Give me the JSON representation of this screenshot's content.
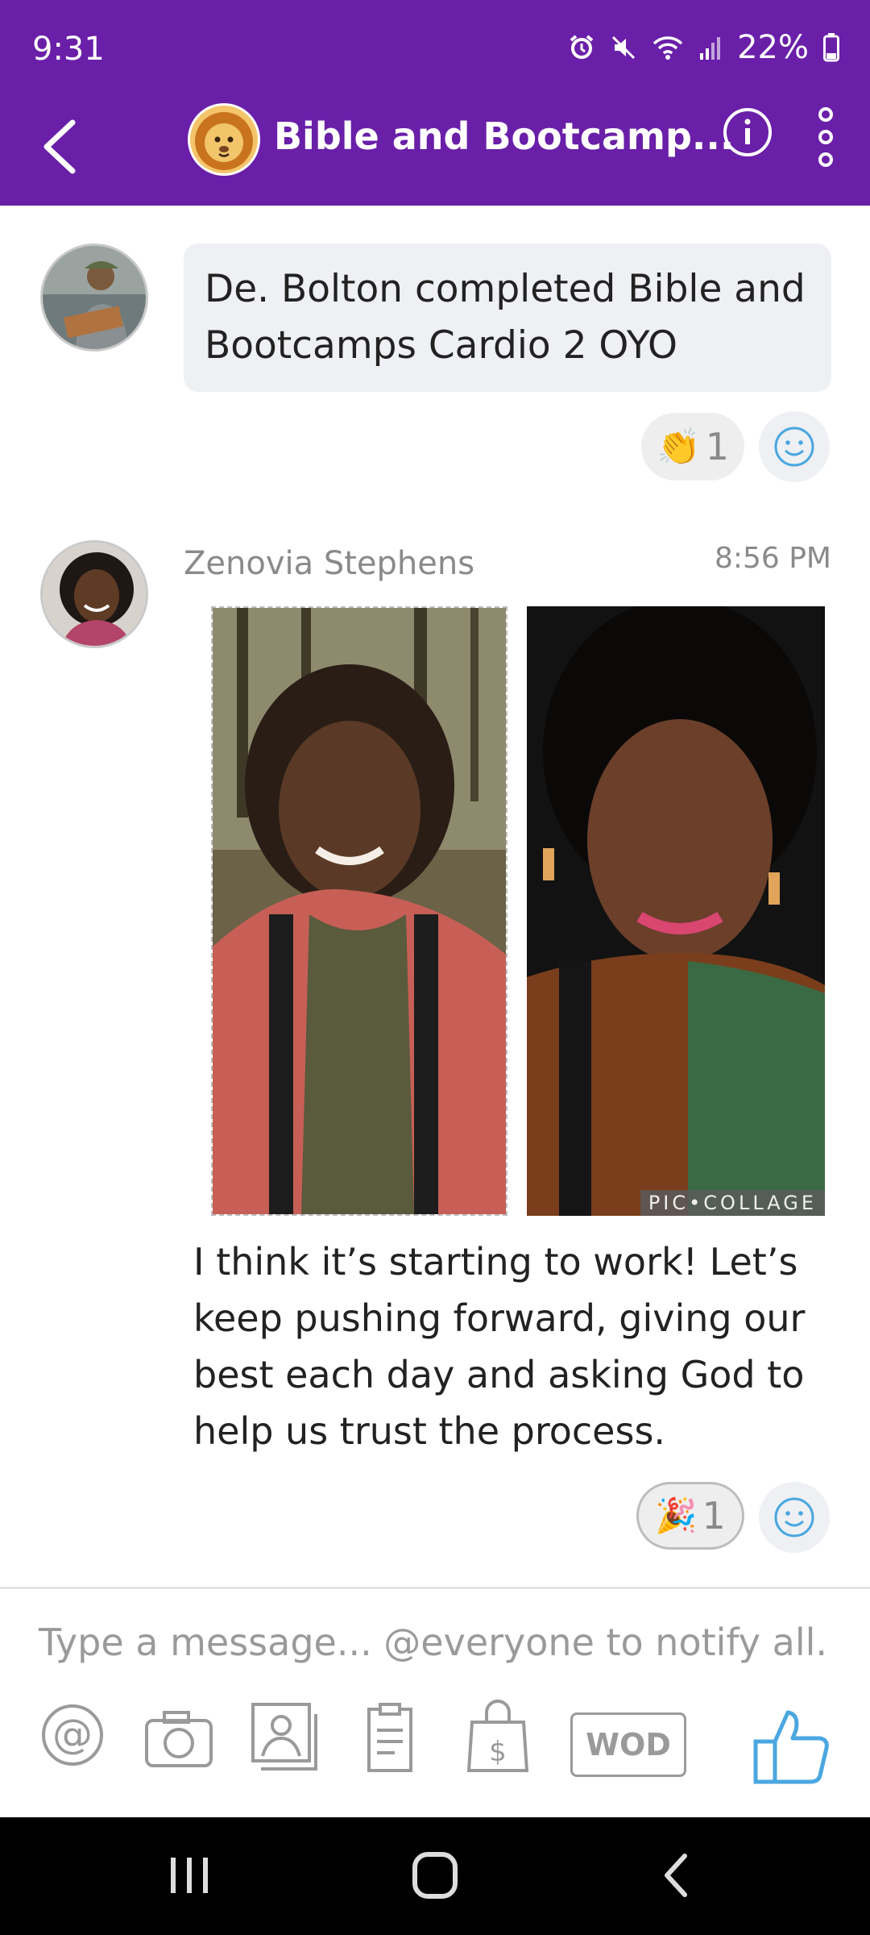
{
  "status_bar": {
    "time": "9:31",
    "battery": "22%",
    "icons": [
      "alarm-icon",
      "mute-icon",
      "wifi-icon",
      "signal-icon",
      "battery-icon"
    ]
  },
  "header": {
    "title": "Bible and Bootcamp...",
    "avatar_icon": "lion-icon"
  },
  "messages": [
    {
      "text": "De. Bolton completed Bible and Bootcamps Cardio 2 OYO",
      "reaction": {
        "emoji": "👏",
        "count": "1"
      }
    },
    {
      "author": "Zenovia Stephens",
      "time": "8:56 PM",
      "image_tag": "PIC•COLLAGE",
      "text": "I think it’s starting to work! Let’s keep pushing forward, giving our best each day and asking God to help us trust the process.",
      "reaction": {
        "emoji": "🎉",
        "count": "1"
      }
    }
  ],
  "composer": {
    "placeholder": "Type a message... @everyone to notify all.",
    "tools": [
      "mention-icon",
      "camera-icon",
      "photo-gallery-icon",
      "document-icon",
      "shop-bag-icon",
      "wod-button",
      "thumbs-up-icon"
    ],
    "wod_label": "WOD"
  },
  "colors": {
    "brand": "#6a1fa8",
    "accent": "#4aa7e0"
  }
}
